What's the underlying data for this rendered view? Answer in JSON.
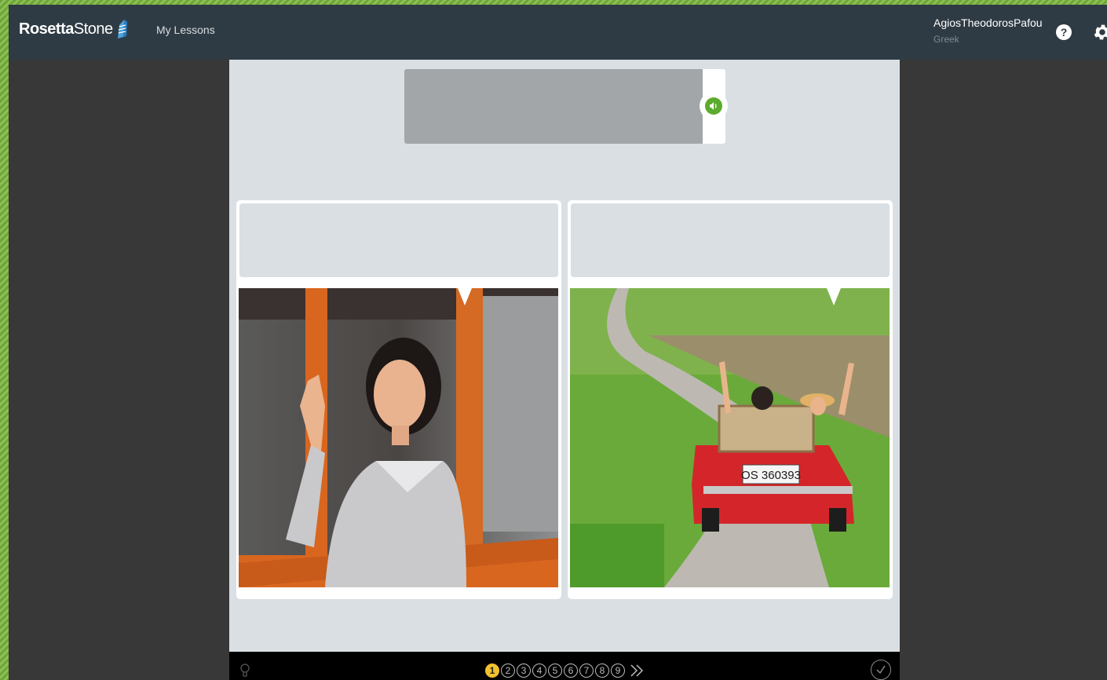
{
  "header": {
    "brand_bold": "Rosetta",
    "brand_light": "Stone",
    "nav_link": "My Lessons",
    "username": "AgiosTheodorosPafou",
    "language": "Greek",
    "help_symbol": "?"
  },
  "icons": {
    "audio": "speaker-icon",
    "help": "question-icon",
    "settings": "gear-icon",
    "hint": "lightbulb-icon",
    "next": "double-chevron-right-icon",
    "submit": "checkmark-icon"
  },
  "cards": [
    {
      "image": "woman waving from window"
    },
    {
      "image": "couple in red convertible on country road",
      "plate": "OS 360393"
    }
  ],
  "progress": {
    "steps": [
      "1",
      "2",
      "3",
      "4",
      "5",
      "6",
      "7",
      "8",
      "9"
    ],
    "current": 1
  },
  "colors": {
    "topbar": "#2f3b44",
    "audio_green": "#5cab2f",
    "active_step": "#f2c12e"
  }
}
